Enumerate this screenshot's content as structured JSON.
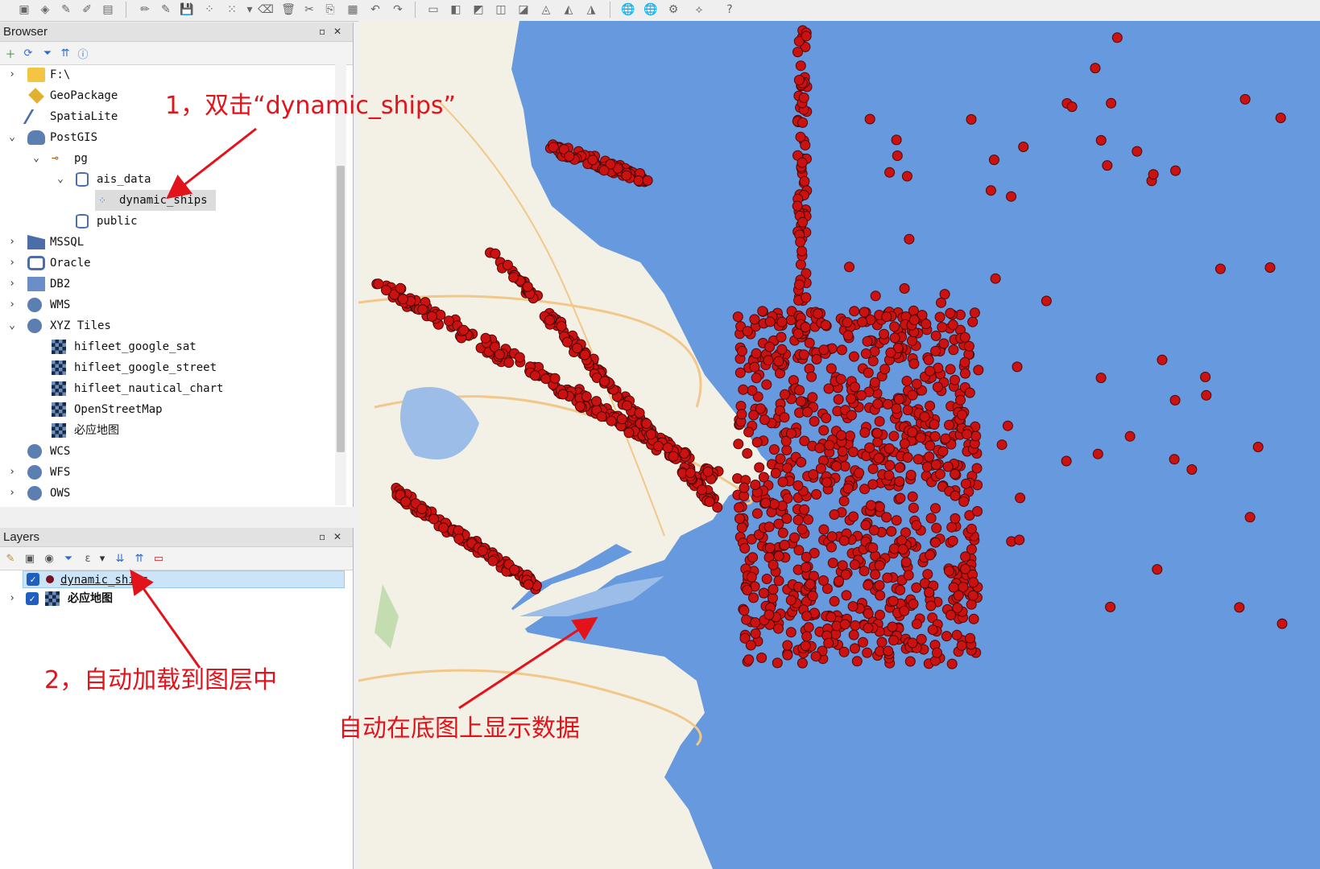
{
  "browser": {
    "title": "Browser",
    "items": [
      {
        "label": "F:\\",
        "icon": "folder-icon"
      },
      {
        "label": "GeoPackage",
        "icon": "geopackage-icon"
      },
      {
        "label": "SpatiaLite",
        "icon": "spatialite-icon"
      },
      {
        "label": "PostGIS",
        "icon": "postgis-elephant-icon"
      },
      {
        "label": "pg",
        "icon": "connection-icon"
      },
      {
        "label": "ais_data",
        "icon": "schema-database-icon"
      },
      {
        "label": "dynamic_ships",
        "icon": "point-layer-icon"
      },
      {
        "label": "public",
        "icon": "schema-database-icon"
      },
      {
        "label": "MSSQL",
        "icon": "mssql-icon"
      },
      {
        "label": "Oracle",
        "icon": "oracle-icon"
      },
      {
        "label": "DB2",
        "icon": "db2-icon"
      },
      {
        "label": "WMS",
        "icon": "wms-globe-icon"
      },
      {
        "label": "XYZ Tiles",
        "icon": "xyz-globe-icon"
      },
      {
        "label": "hifleet_google_sat",
        "icon": "tile-icon"
      },
      {
        "label": "hifleet_google_street",
        "icon": "tile-icon"
      },
      {
        "label": "hifleet_nautical_chart",
        "icon": "tile-icon"
      },
      {
        "label": "OpenStreetMap",
        "icon": "tile-icon"
      },
      {
        "label": "必应地图",
        "icon": "tile-icon"
      },
      {
        "label": "WCS",
        "icon": "wcs-globe-icon"
      },
      {
        "label": "WFS",
        "icon": "wfs-globe-icon"
      },
      {
        "label": "OWS",
        "icon": "ows-globe-icon"
      }
    ]
  },
  "layers": {
    "title": "Layers",
    "items": [
      {
        "label": "dynamic_ships",
        "checked": true,
        "icon": "point-symbol-icon"
      },
      {
        "label": "必应地图",
        "checked": true,
        "icon": "tile-icon"
      }
    ]
  },
  "annotations": {
    "step1": "1，双击“dynamic_ships”",
    "step2": "2，自动加载到图层中",
    "step3": "自动在底图上显示数据"
  },
  "colors": {
    "sea": "#6699dd",
    "land": "#f3f0e6",
    "point": "#cc1111",
    "annotation": "#e3131b",
    "selection": "#cce4f7"
  }
}
